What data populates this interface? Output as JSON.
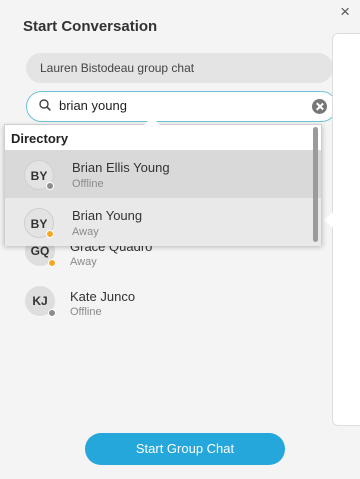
{
  "window": {
    "close_glyph": "×"
  },
  "title": "Start Conversation",
  "chat_name": "Lauren Bistodeau group chat",
  "search": {
    "value": "brian young",
    "icon": "search-icon",
    "clear_icon": "clear-icon"
  },
  "contacts": [
    {
      "initials": "GQ",
      "name": "Grace Quadro",
      "status": "Away",
      "status_color": "#f5a623"
    },
    {
      "initials": "KJ",
      "name": "Kate Junco",
      "status": "Offline",
      "status_color": "#8c8c8c"
    }
  ],
  "directory": {
    "heading": "Directory",
    "results": [
      {
        "initials": "BY",
        "name": "Brian Ellis Young",
        "status": "Offline",
        "status_color": "#8c8c8c",
        "selected": true
      },
      {
        "initials": "BY",
        "name": "Brian Young",
        "status": "Away",
        "status_color": "#f5a623",
        "selected": false
      }
    ]
  },
  "footer": {
    "start_group_chat_label": "Start Group Chat"
  },
  "colors": {
    "accent": "#25a7dc",
    "search_border": "#6dc3d6"
  }
}
